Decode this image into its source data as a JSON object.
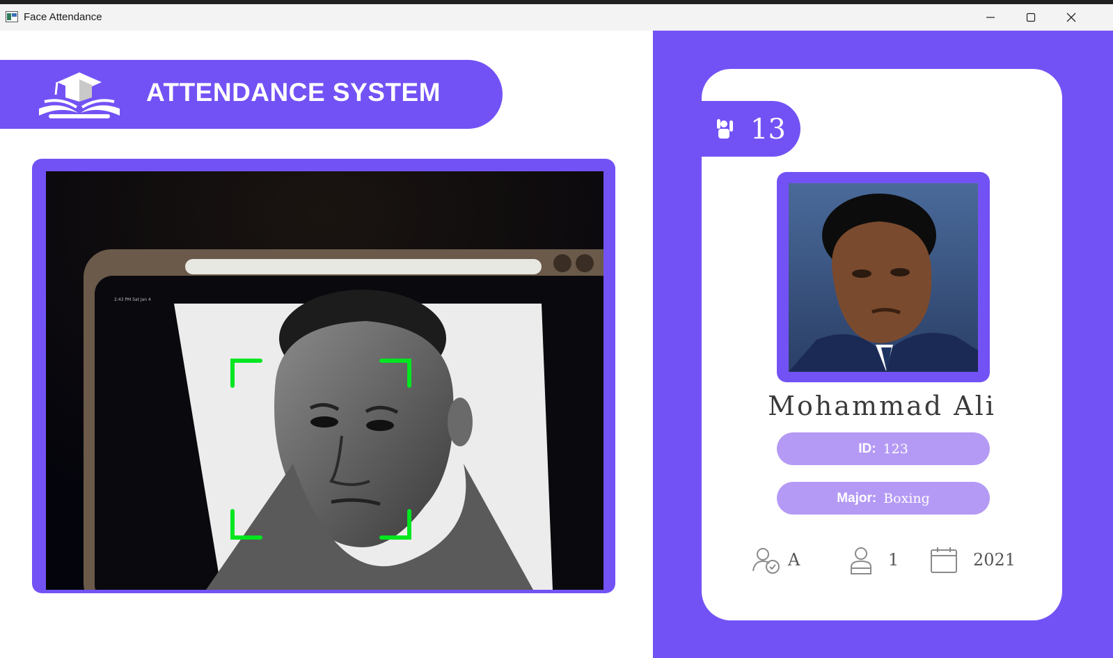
{
  "window": {
    "title": "Face Attendance",
    "icon": "app-window-icon",
    "controls": [
      "minimize-icon",
      "maximize-icon",
      "close-icon"
    ]
  },
  "header": {
    "title": "ATTENDANCE SYSTEM",
    "logo": "graduation-cap-book-icon"
  },
  "webcam": {
    "face_box_color": "#00e620",
    "ipad_status": "2:43 PM  Sat Jan 4"
  },
  "student": {
    "total_attendance": "13",
    "name": "Mohammad Ali",
    "id_label": "ID:",
    "id_value": "123",
    "major_label": "Major:",
    "major_value": "Boxing",
    "standing": "A",
    "year": "1",
    "starting_year": "2021"
  },
  "colors": {
    "accent": "#7352f5",
    "pill": "#b49af5",
    "face_box": "#00e620"
  }
}
